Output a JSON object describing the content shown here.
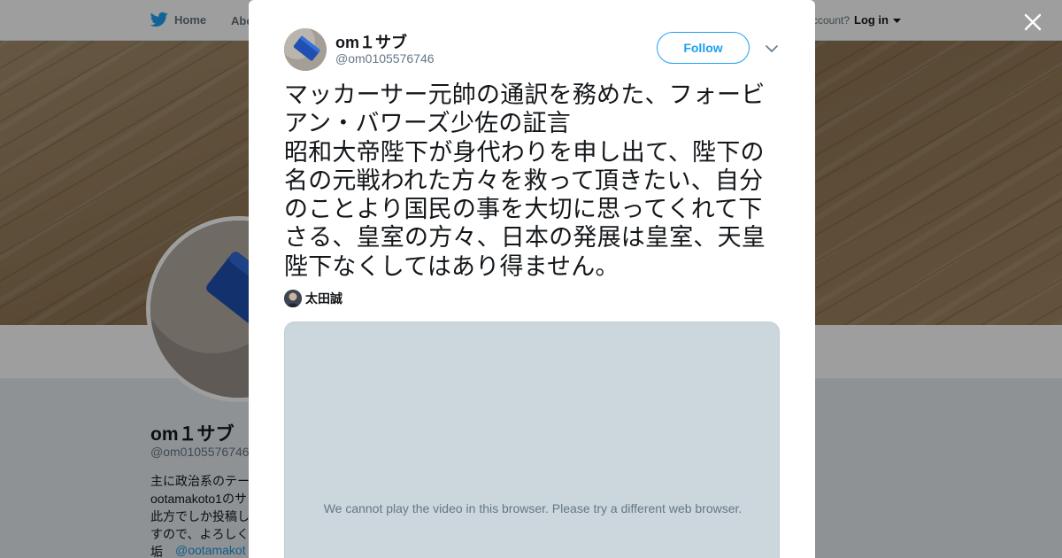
{
  "background": {
    "nav": {
      "home_label": "Home",
      "about_label": "Abo",
      "account_text": "ccount?",
      "login_label": "Log in"
    },
    "profile": {
      "name": "om１サブ",
      "handle": "@om0105576746",
      "bio": "主に政治系のテー\nootamakoto1のサ\n此方でしか投稿し\nすので、よろしく\n垢",
      "bio_link": "@ootamakot"
    }
  },
  "modal": {
    "author": {
      "name": "om１サブ",
      "handle": "@om0105576746"
    },
    "follow_label": "Follow",
    "tweet_text": "マッカーサー元帥の通訳を務めた、フォービアン・バワーズ少佐の証言\n昭和大帝陛下が身代わりを申し出て、陛下の名の元戦われた方々を救って頂きたい、自分のことより国民の事を大切に思ってくれて下さる、皇室の方々、日本の発展は皇室、天皇陛下なくしてはあり得ません。",
    "quoted_user": "太田誠",
    "video_message": "We cannot play the video in this browser. Please try a different web browser."
  },
  "icons": {
    "twitter": "twitter-bird-icon",
    "close": "close-icon",
    "chevron": "chevron-down-icon"
  },
  "colors": {
    "brand": "#1da1f2",
    "text": "#14171a",
    "muted": "#657786",
    "video_bg": "#ccd6dd"
  }
}
